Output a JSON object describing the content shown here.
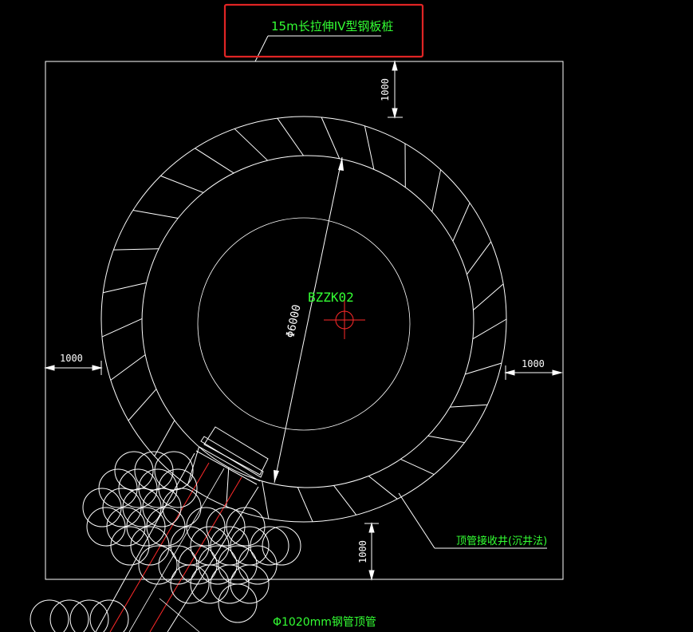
{
  "drawing": {
    "label_sheet_pile": "15m长拉伸IV型钢板桩",
    "label_center": "BZZK02",
    "label_diameter": "Φ6000",
    "dim_top": "1000",
    "dim_left": "1000",
    "dim_right": "1000",
    "dim_bottom": "1000",
    "label_receiving_well": "顶管接收井(沉井法)",
    "label_steel_pipe": "Φ1020mm钢管顶管"
  },
  "colors": {
    "background": "#000000",
    "linework": "#ffffff",
    "text": "#33ff33",
    "pipe_axis": "#ff2a2a",
    "center_mark": "#ff2a2a",
    "highlight_box": "#e02424"
  }
}
